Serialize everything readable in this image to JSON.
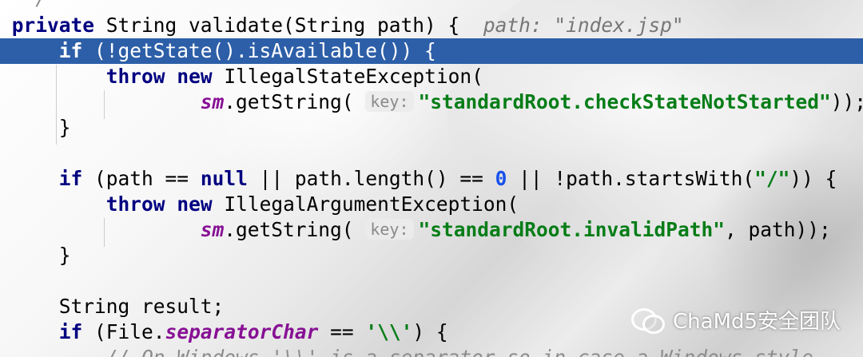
{
  "code": {
    "fragment_top": "*/",
    "l1": {
      "kw": "private",
      "rest": " String validate(String path) {",
      "hint": "path: \"index.jsp\""
    },
    "l2": {
      "indent": "    ",
      "kw": "if",
      "rest": " (!getState().isAvailable()) {"
    },
    "l3": {
      "indent": "        ",
      "kw1": "throw",
      "kw2": "new",
      "rest": " IllegalStateException("
    },
    "l4": {
      "indent": "                ",
      "field": "sm",
      "call": ".getString(",
      "hint": "key:",
      "str": "\"standardRoot.checkStateNotStarted\"",
      "tail": "));"
    },
    "l5": {
      "indent": "    ",
      "text": "}"
    },
    "l6": {
      "indent": "    ",
      "kw": "if",
      "p1": " (path == ",
      "null": "null",
      "p2": " || path.length() == ",
      "zero": "0",
      "p3": " || !path.startsWith(",
      "slash": "\"/\"",
      "p4": ")) {"
    },
    "l7": {
      "indent": "        ",
      "kw1": "throw",
      "kw2": "new",
      "rest": " IllegalArgumentException("
    },
    "l8": {
      "indent": "                ",
      "field": "sm",
      "call": ".getString(",
      "hint": "key:",
      "str": "\"standardRoot.invalidPath\"",
      "tail": ", path));"
    },
    "l9": {
      "indent": "    ",
      "text": "}"
    },
    "l10": {
      "indent": "    ",
      "text": "String result;"
    },
    "l11": {
      "indent": "    ",
      "kw": "if",
      "p1": " (File.",
      "field": "separatorChar",
      "p2": " == ",
      "chr": "'\\\\'",
      "p3": ") {"
    },
    "l12": {
      "indent": "        ",
      "comment": "// On Windows '\\\\' is a separator so in case a Windows style"
    }
  },
  "watermark": {
    "text": "ChaMd5安全团队",
    "icon": "wechat-icon"
  },
  "colors": {
    "highlight": "#2d5fa8",
    "keyword": "#000080",
    "string": "#067d17",
    "number": "#1750eb",
    "field": "#871094"
  }
}
